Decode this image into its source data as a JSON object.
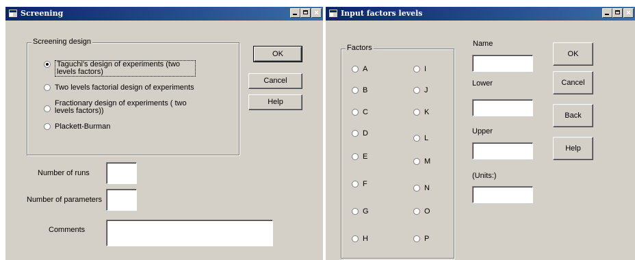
{
  "screening": {
    "title": "Screening",
    "group_label": "Screening design",
    "options": [
      {
        "label": "Taguchi's design of experiments (two levels factors)",
        "selected": true
      },
      {
        "label": "Two levels factorial design of experiments",
        "selected": false
      },
      {
        "label": "Fractionary design of experiments ( two levels factors))",
        "selected": false
      },
      {
        "label": "Plackett-Burman",
        "selected": false
      }
    ],
    "ok_label": "OK",
    "cancel_label": "Cancel",
    "help_label": "Help",
    "runs_label": "Number of runs",
    "runs_value": "",
    "params_label": "Number of parameters",
    "params_value": "",
    "comments_label": "Comments",
    "comments_value": ""
  },
  "input_factors": {
    "title": "Input factors levels",
    "group_label": "Factors",
    "factors_left": [
      "A",
      "B",
      "C",
      "D",
      "E",
      "F",
      "G",
      "H"
    ],
    "factors_right": [
      "I",
      "J",
      "K",
      "L",
      "M",
      "N",
      "O",
      "P"
    ],
    "name_label": "Name",
    "lower_label": "Lower",
    "upper_label": "Upper",
    "units_label": "(Units:)",
    "ok_label": "OK",
    "cancel_label": "Cancel",
    "back_label": "Back",
    "help_label": "Help"
  },
  "colors": {
    "titlebar_start": "#0a246a",
    "titlebar_end": "#3a6ea5",
    "face": "#d4d0c8"
  },
  "icons": [
    "app-icon",
    "minimize-icon",
    "maximize-icon",
    "close-icon"
  ]
}
